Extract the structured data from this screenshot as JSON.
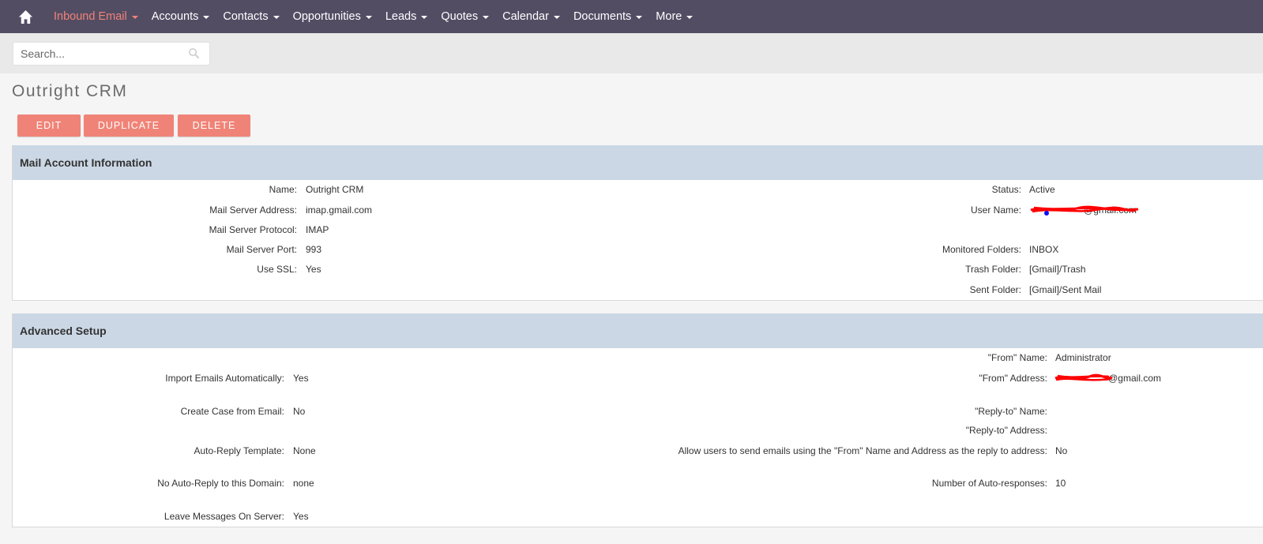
{
  "nav": {
    "items": [
      {
        "label": "Inbound Email",
        "active": true
      },
      {
        "label": "Accounts"
      },
      {
        "label": "Contacts"
      },
      {
        "label": "Opportunities"
      },
      {
        "label": "Leads"
      },
      {
        "label": "Quotes"
      },
      {
        "label": "Calendar"
      },
      {
        "label": "Documents"
      },
      {
        "label": "More"
      }
    ]
  },
  "search": {
    "placeholder": "Search...",
    "value": ""
  },
  "page": {
    "title": "Outright CRM"
  },
  "actions": {
    "edit": "EDIT",
    "duplicate": "DUPLICATE",
    "delete": "DELETE"
  },
  "mail_account": {
    "heading": "Mail Account Information",
    "fields": {
      "name": {
        "label": "Name:",
        "value": "Outright CRM"
      },
      "server_address": {
        "label": "Mail Server Address:",
        "value": "imap.gmail.com"
      },
      "protocol": {
        "label": "Mail Server Protocol:",
        "value": "IMAP"
      },
      "port": {
        "label": "Mail Server Port:",
        "value": "993"
      },
      "ssl": {
        "label": "Use SSL:",
        "value": "Yes"
      },
      "status": {
        "label": "Status:",
        "value": "Active"
      },
      "user_name": {
        "label": "User Name:",
        "value": "@gmail.com"
      },
      "monitored": {
        "label": "Monitored Folders:",
        "value": "INBOX"
      },
      "trash": {
        "label": "Trash Folder:",
        "value": "[Gmail]/Trash"
      },
      "sent": {
        "label": "Sent Folder:",
        "value": "[Gmail]/Sent Mail"
      }
    }
  },
  "advanced": {
    "heading": "Advanced Setup",
    "fields": {
      "import_auto": {
        "label": "Import Emails Automatically:",
        "value": "Yes"
      },
      "create_case": {
        "label": "Create Case from Email:",
        "value": "No"
      },
      "auto_reply_tpl": {
        "label": "Auto-Reply Template:",
        "value": "None"
      },
      "no_auto_reply_domain": {
        "label": "No Auto-Reply to this Domain:",
        "value": "none"
      },
      "leave_messages": {
        "label": "Leave Messages On Server:",
        "value": "Yes"
      },
      "from_name": {
        "label": "\"From\" Name:",
        "value": "Administrator"
      },
      "from_address": {
        "label": "\"From\" Address:",
        "value": "@gmail.com"
      },
      "reply_to_name": {
        "label": "\"Reply-to\" Name:",
        "value": ""
      },
      "reply_to_address": {
        "label": "\"Reply-to\" Address:",
        "value": ""
      },
      "allow_users": {
        "label": "Allow users to send emails using the \"From\" Name and Address as the reply to address:",
        "value": "No"
      },
      "num_auto_responses": {
        "label": "Number of Auto-responses:",
        "value": "10"
      }
    }
  },
  "colors": {
    "nav_bg": "#534d64",
    "accent": "#f08377",
    "panel_head": "#cbd7e4",
    "redaction": "#ff0000"
  }
}
